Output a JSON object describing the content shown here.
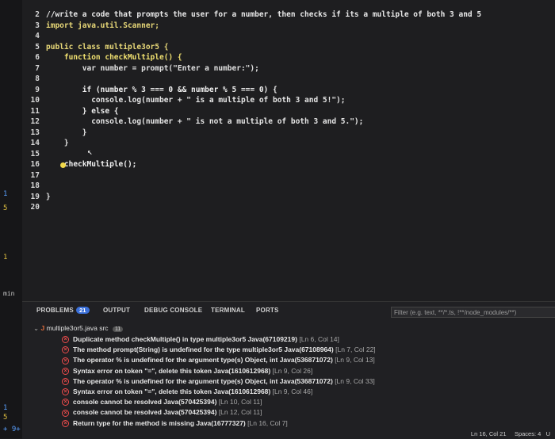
{
  "left_gutter": [
    "1",
    "5",
    "1",
    "min",
    "1",
    "5",
    "+ 9+"
  ],
  "editor": {
    "lines": [
      {
        "n": "2",
        "text": "//write a code that prompts the user for a number, then checks if its a multiple of both 3 and 5"
      },
      {
        "n": "3",
        "text": "import java.util.Scanner;"
      },
      {
        "n": "4",
        "text": ""
      },
      {
        "n": "5",
        "text": "public class multiple3or5 {"
      },
      {
        "n": "6",
        "text": "    function checkMultiple() {"
      },
      {
        "n": "7",
        "text": "        var number = prompt(\"Enter a number:\");"
      },
      {
        "n": "8",
        "text": ""
      },
      {
        "n": "9",
        "text": "        if (number % 3 === 0 && number % 5 === 0) {"
      },
      {
        "n": "10",
        "text": "          console.log(number + \" is a multiple of both 3 and 5!\");"
      },
      {
        "n": "11",
        "text": "        } else {"
      },
      {
        "n": "12",
        "text": "          console.log(number + \" is not a multiple of both 3 and 5.\");"
      },
      {
        "n": "13",
        "text": "        }"
      },
      {
        "n": "14",
        "text": "    }"
      },
      {
        "n": "15",
        "text": ""
      },
      {
        "n": "16",
        "text": "    checkMultiple();"
      },
      {
        "n": "17",
        "text": ""
      },
      {
        "n": "18",
        "text": ""
      },
      {
        "n": "19",
        "text": "}"
      },
      {
        "n": "20",
        "text": ""
      }
    ]
  },
  "panel": {
    "tabs": {
      "problems": "PROBLEMS",
      "problems_count": "21",
      "output": "OUTPUT",
      "debug_console": "DEBUG CONSOLE",
      "terminal": "TERMINAL",
      "ports": "PORTS"
    },
    "filter_placeholder": "Filter (e.g. text, **/*.ts, !**/node_modules/**)",
    "file": {
      "name": "multiple3or5.java src",
      "count": "11"
    },
    "problems": [
      {
        "msg": "Duplicate method checkMultiple() in type multiple3or5 Java(67109219)",
        "loc": "[Ln 6, Col 14]"
      },
      {
        "msg": "The method prompt(String) is undefined for the type multiple3or5 Java(67108964)",
        "loc": "[Ln 7, Col 22]"
      },
      {
        "msg": "The operator % is undefined for the argument type(s) Object, int Java(536871072)",
        "loc": "[Ln 9, Col 13]"
      },
      {
        "msg": "Syntax error on token \"=\", delete this token Java(1610612968)",
        "loc": "[Ln 9, Col 26]"
      },
      {
        "msg": "The operator % is undefined for the argument type(s) Object, int Java(536871072)",
        "loc": "[Ln 9, Col 33]"
      },
      {
        "msg": "Syntax error on token \"=\", delete this token Java(1610612968)",
        "loc": "[Ln 9, Col 46]"
      },
      {
        "msg": "console cannot be resolved Java(570425394)",
        "loc": "[Ln 10, Col 11]"
      },
      {
        "msg": "console cannot be resolved Java(570425394)",
        "loc": "[Ln 12, Col 11]"
      },
      {
        "msg": "Return type for the method is missing Java(16777327)",
        "loc": "[Ln 16, Col 7]"
      }
    ]
  },
  "status": {
    "position": "Ln 16, Col 21",
    "spaces": "Spaces: 4",
    "extra": "U"
  }
}
